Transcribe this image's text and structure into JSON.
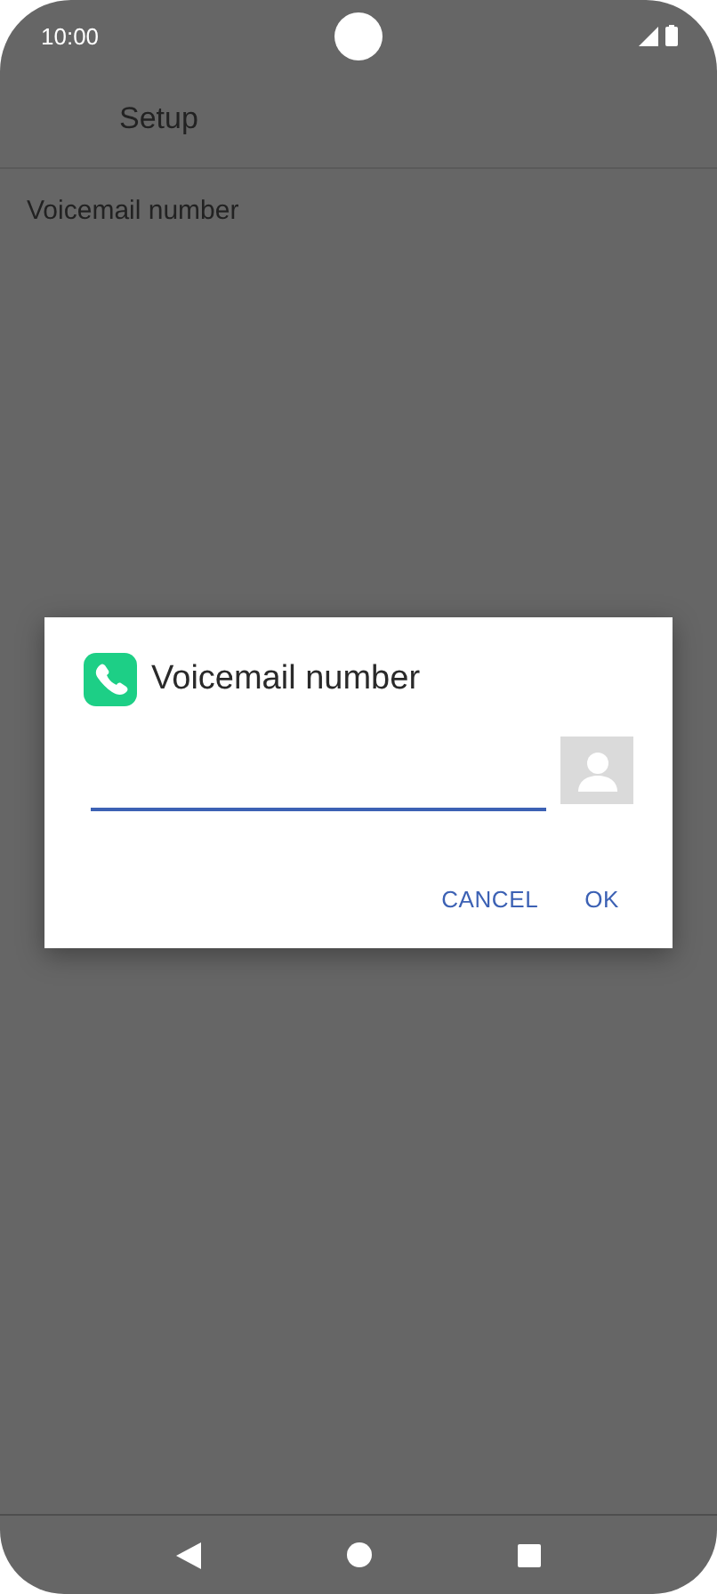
{
  "status_bar": {
    "time": "10:00"
  },
  "app_bar": {
    "title": "Setup"
  },
  "settings": [
    {
      "label": "Voicemail number"
    }
  ],
  "dialog": {
    "title": "Voicemail number",
    "buttons": [
      "CANCEL",
      "OK"
    ]
  }
}
